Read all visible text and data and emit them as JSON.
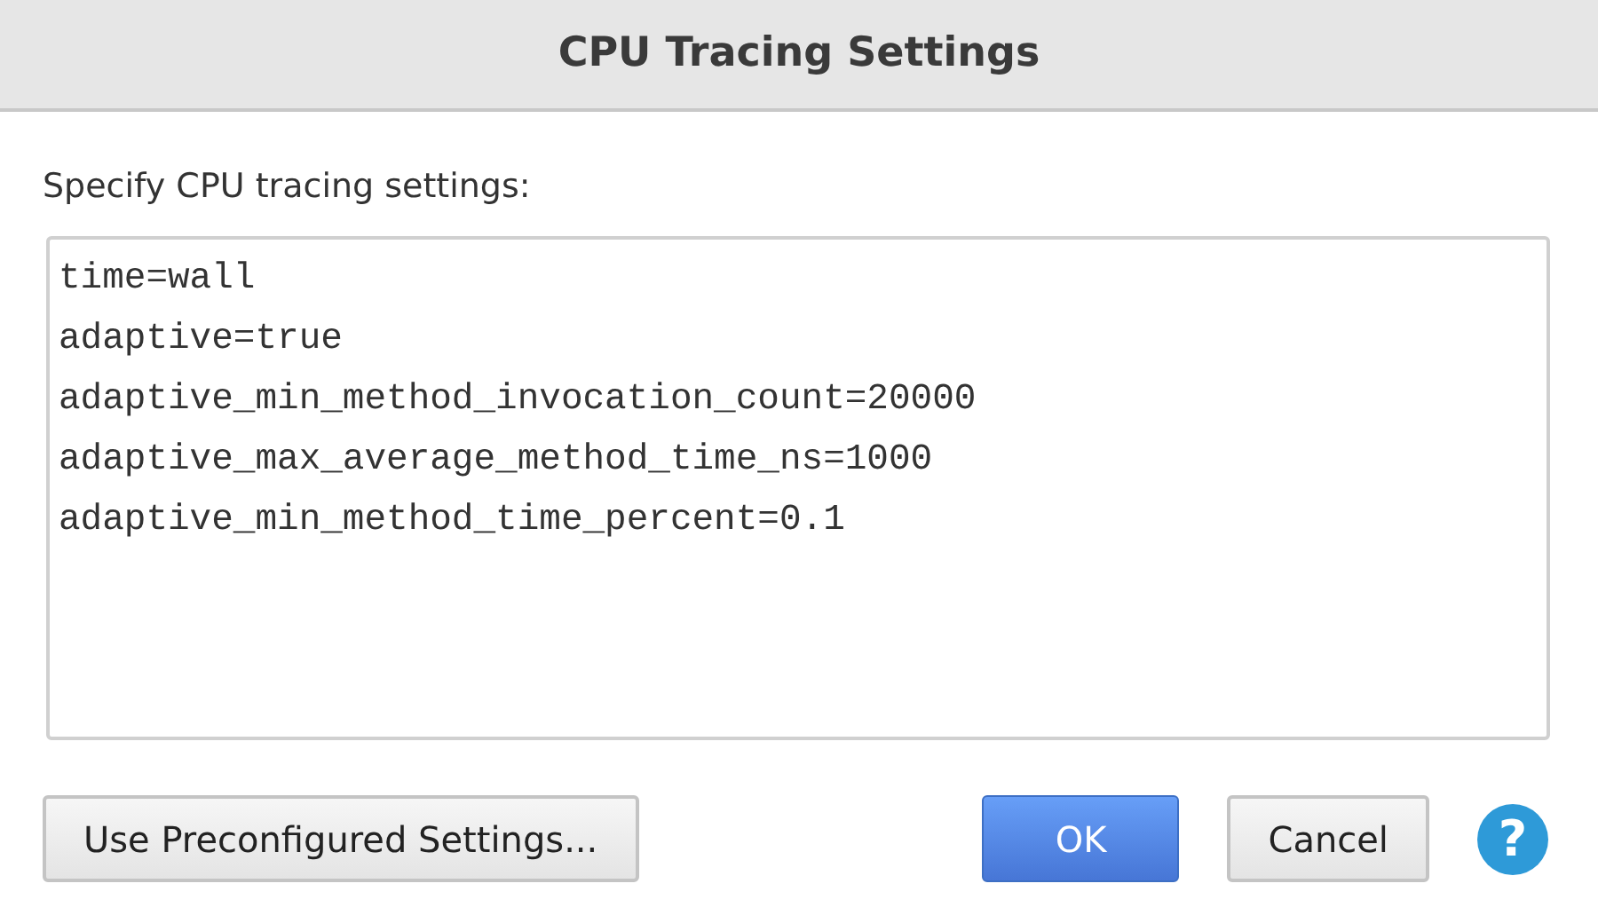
{
  "window": {
    "title": "CPU Tracing Settings"
  },
  "prompt": "Specify CPU tracing settings:",
  "settings_field": {
    "lines": [
      "time=wall",
      "adaptive=true",
      "adaptive_min_method_invocation_count=20000",
      "adaptive_max_average_method_time_ns=1000",
      "adaptive_min_method_time_percent=0.1"
    ]
  },
  "left_button": {
    "label": "Use Preconfigured Settings...",
    "kind": "secondary"
  },
  "buttons": [
    {
      "label": "OK",
      "kind": "primary"
    },
    {
      "label": "Cancel",
      "kind": "secondary"
    }
  ],
  "help": {
    "label": "?"
  }
}
